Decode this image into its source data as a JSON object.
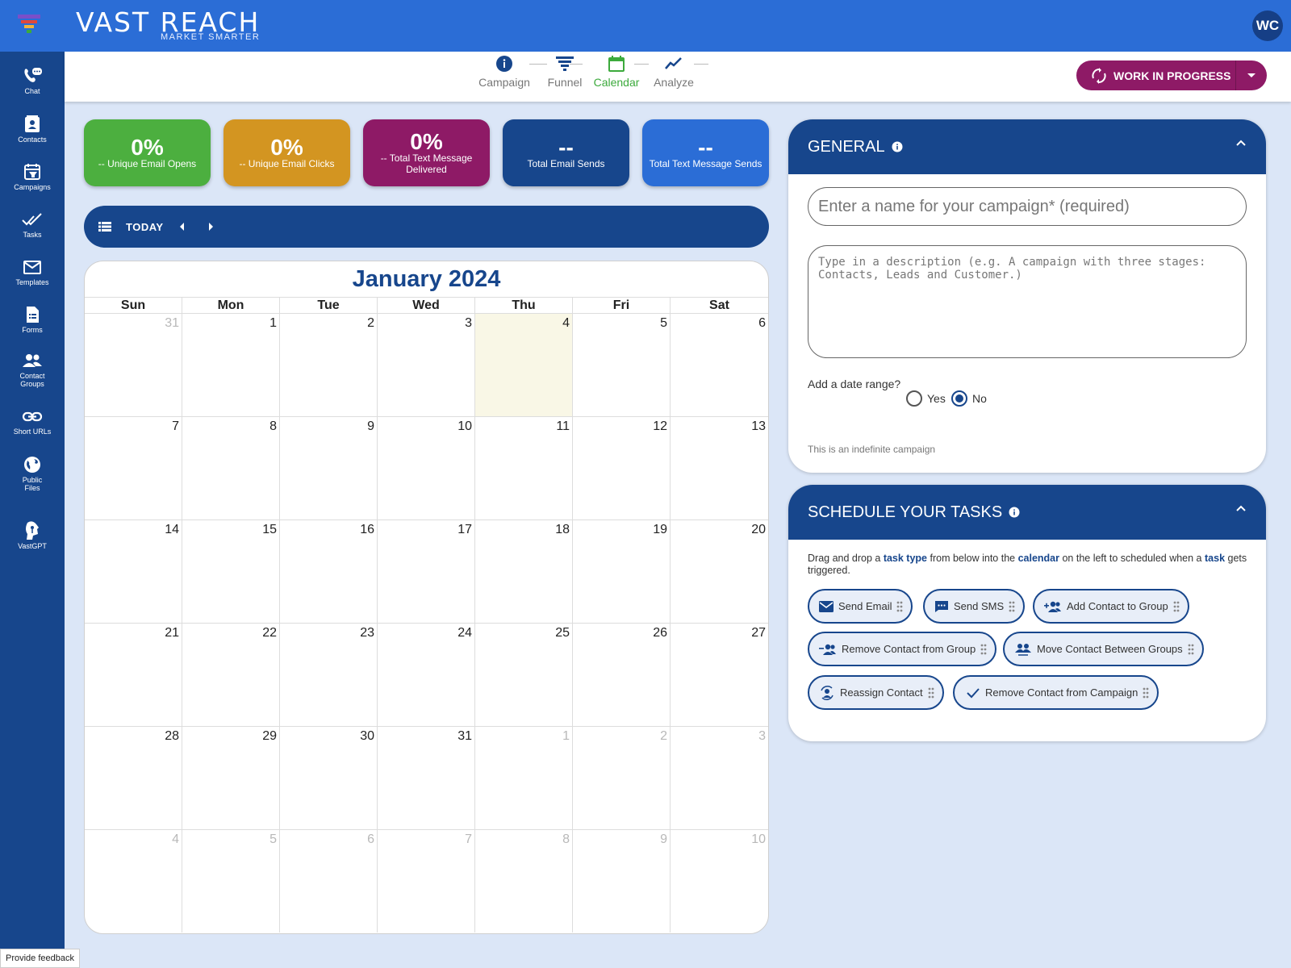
{
  "header": {
    "brand_name": "VAST REACH",
    "brand_tagline": "MARKET SMARTER",
    "user_initials": "WC",
    "brand_color": "#2b6dd6"
  },
  "sidebar": {
    "items": [
      {
        "label": "Chat",
        "icon": "chat-icon"
      },
      {
        "label": "Contacts",
        "icon": "contacts-icon"
      },
      {
        "label": "Campaigns",
        "icon": "campaigns-icon"
      },
      {
        "label": "Tasks",
        "icon": "tasks-icon"
      },
      {
        "label": "Templates",
        "icon": "templates-icon"
      },
      {
        "label": "Forms",
        "icon": "forms-icon"
      },
      {
        "label": "Contact Groups",
        "icon": "contact-groups-icon"
      },
      {
        "label": "Short URLs",
        "icon": "link-icon"
      },
      {
        "label": "Public Files",
        "icon": "globe-icon"
      },
      {
        "label": "VastGPT",
        "icon": "gpt-icon"
      }
    ]
  },
  "stepper": {
    "steps": [
      {
        "label": "Campaign",
        "icon": "info-icon"
      },
      {
        "label": "Funnel",
        "icon": "funnel-icon"
      },
      {
        "label": "Calendar",
        "icon": "calendar-icon"
      },
      {
        "label": "Analyze",
        "icon": "trend-icon"
      }
    ],
    "active": "Calendar",
    "status_button": "WORK IN PROGRESS"
  },
  "stats": [
    {
      "value": "0%",
      "label": "-- Unique Email Opens",
      "color": "#4caf3f"
    },
    {
      "value": "0%",
      "label": "-- Unique Email Clicks",
      "color": "#d39521"
    },
    {
      "value": "0%",
      "label": "-- Total Text Message Delivered",
      "color": "#8e1a66"
    },
    {
      "value": "--",
      "label": "Total Email Sends",
      "color": "#17468c"
    },
    {
      "value": "--",
      "label": "Total Text Message Sends",
      "color": "#2b6dd6"
    }
  ],
  "calendar_toolbar": {
    "today_label": "TODAY"
  },
  "calendar": {
    "title": "January 2024",
    "weekdays": [
      "Sun",
      "Mon",
      "Tue",
      "Wed",
      "Thu",
      "Fri",
      "Sat"
    ],
    "days": [
      "31",
      "1",
      "2",
      "3",
      "4",
      "5",
      "6",
      "7",
      "8",
      "9",
      "10",
      "11",
      "12",
      "13",
      "14",
      "15",
      "16",
      "17",
      "18",
      "19",
      "20",
      "21",
      "22",
      "23",
      "24",
      "25",
      "26",
      "27",
      "28",
      "29",
      "30",
      "31",
      "1",
      "2",
      "3",
      "4",
      "5",
      "6",
      "7",
      "8",
      "9",
      "10"
    ],
    "today_index": 4
  },
  "general": {
    "title": "GENERAL",
    "name_placeholder": "Enter a name for your campaign* (required)",
    "description_placeholder": "Type in a description (e.g. A campaign with three stages: Contacts, Leads and Customer.)",
    "date_range_question": "Add a date range?",
    "option_yes": "Yes",
    "option_no": "No",
    "selected": "No",
    "note": "This is an indefinite campaign"
  },
  "schedule": {
    "title": "SCHEDULE YOUR TASKS",
    "help": {
      "t1": "Drag and drop a ",
      "b1": "task type",
      "t2": " from below into the ",
      "b2": "calendar",
      "t3": " on the left to scheduled when a ",
      "b3": "task",
      "t4": " gets triggered."
    },
    "tasks": [
      {
        "label": "Send Email",
        "icon": "mail-icon"
      },
      {
        "label": "Send SMS",
        "icon": "sms-icon"
      },
      {
        "label": "Add Contact to Group",
        "icon": "group-add-icon"
      },
      {
        "label": "Remove Contact from Group",
        "icon": "group-remove-icon"
      },
      {
        "label": "Move Contact Between Groups",
        "icon": "group-move-icon"
      },
      {
        "label": "Reassign Contact",
        "icon": "reassign-icon"
      },
      {
        "label": "Remove Contact from Campaign",
        "icon": "check-icon"
      }
    ]
  },
  "feedback_label": "Provide feedback"
}
